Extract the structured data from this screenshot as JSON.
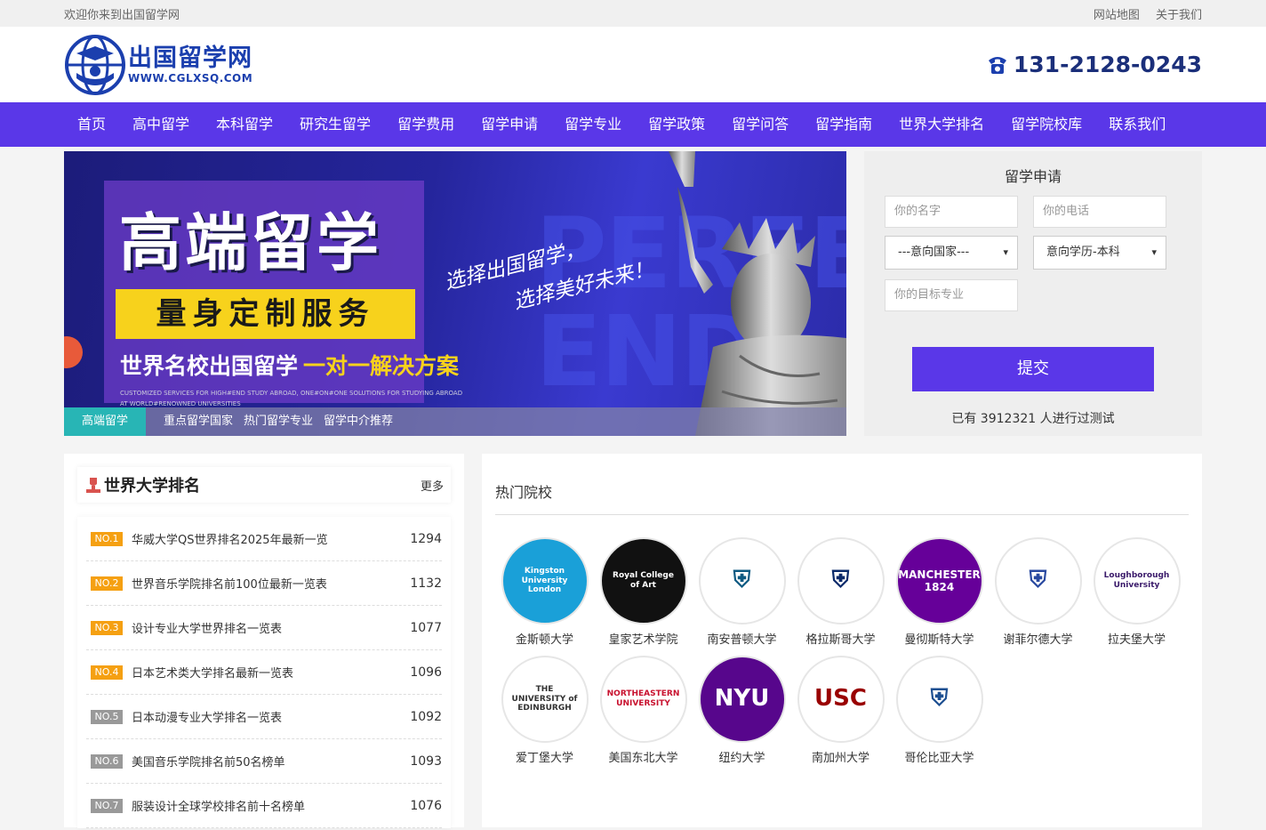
{
  "topbar": {
    "welcome": "欢迎你来到出国留学网",
    "sitemap": "网站地图",
    "about": "关于我们"
  },
  "header": {
    "logo_title": "出国留学网",
    "logo_sub": "WWW.CGLXSQ.COM",
    "phone": "131-2128-0243"
  },
  "nav": [
    "首页",
    "高中留学",
    "本科留学",
    "研究生留学",
    "留学费用",
    "留学申请",
    "留学专业",
    "留学政策",
    "留学问答",
    "留学指南",
    "世界大学排名",
    "留学院校库",
    "联系我们"
  ],
  "banner": {
    "big": "高端留学",
    "yellow": "量身定制服务",
    "line_a": "世界名校出国留学",
    "line_b": "一对一解决方案",
    "small": "CUSTOMIZED SERVICES FOR HIGH#END STUDY ABROAD, ONE#ON#ONE SOLUTIONS FOR STUDYING ABROAD AT WORLD#RENOWNED UNIVERSITIES",
    "script_1": "选择出国留学，",
    "script_2": "选择美好未来！",
    "bg_text_1": "PERFEC",
    "bg_text_2": "END",
    "tabs": [
      "高端留学",
      "重点留学国家",
      "热门留学专业",
      "留学中介推荐"
    ]
  },
  "form": {
    "title": "留学申请",
    "name_placeholder": "你的名字",
    "phone_placeholder": "你的电话",
    "country_value": "---意向国家---",
    "degree_value": "意向学历-本科",
    "major_placeholder": "你的目标专业",
    "submit": "提交",
    "count_text": "已有 3912321 人进行过测试"
  },
  "ranking": {
    "title": "世界大学排名",
    "more": "更多",
    "items": [
      {
        "no": "NO.1",
        "text": "华威大学QS世界排名2025年最新一览",
        "count": "1294"
      },
      {
        "no": "NO.2",
        "text": "世界音乐学院排名前100位最新一览表",
        "count": "1132"
      },
      {
        "no": "NO.3",
        "text": "设计专业大学世界排名一览表",
        "count": "1077"
      },
      {
        "no": "NO.4",
        "text": "日本艺术类大学排名最新一览表",
        "count": "1096"
      },
      {
        "no": "NO.5",
        "text": "日本动漫专业大学排名一览表",
        "count": "1092"
      },
      {
        "no": "NO.6",
        "text": "美国音乐学院排名前50名榜单",
        "count": "1093"
      },
      {
        "no": "NO.7",
        "text": "服装设计全球学校排名前十名榜单",
        "count": "1076"
      }
    ]
  },
  "hot": {
    "title": "热门院校",
    "schools": [
      {
        "name": "金斯顿大学",
        "logo_text": "Kingston University London",
        "bg": "#1aa0d8",
        "fg": "#ffffff"
      },
      {
        "name": "皇家艺术学院",
        "logo_text": "Royal College of Art",
        "bg": "#111111",
        "fg": "#ffffff"
      },
      {
        "name": "南安普顿大学",
        "logo_text": "⛨",
        "bg": "#ffffff",
        "fg": "#0e5a82"
      },
      {
        "name": "格拉斯哥大学",
        "logo_text": "⛨",
        "bg": "#ffffff",
        "fg": "#0a2a6a"
      },
      {
        "name": "曼彻斯特大学",
        "logo_text": "MANCHESTER 1824",
        "bg": "#660099",
        "fg": "#ffffff"
      },
      {
        "name": "谢菲尔德大学",
        "logo_text": "⛨",
        "bg": "#ffffff",
        "fg": "#2a4aa0"
      },
      {
        "name": "拉夫堡大学",
        "logo_text": "Loughborough University",
        "bg": "#ffffff",
        "fg": "#3a1a6a"
      },
      {
        "name": "爱丁堡大学",
        "logo_text": "THE UNIVERSITY of EDINBURGH",
        "bg": "#ffffff",
        "fg": "#333333"
      },
      {
        "name": "美国东北大学",
        "logo_text": "NORTHEASTERN UNIVERSITY",
        "bg": "#ffffff",
        "fg": "#c8102e"
      },
      {
        "name": "纽约大学",
        "logo_text": "NYU",
        "bg": "#57068c",
        "fg": "#ffffff"
      },
      {
        "name": "南加州大学",
        "logo_text": "USC",
        "bg": "#ffffff",
        "fg": "#990000"
      },
      {
        "name": "哥伦比亚大学",
        "logo_text": "⛨",
        "bg": "#ffffff",
        "fg": "#1d4f91"
      }
    ]
  },
  "colors": {
    "brand": "#5a37e8",
    "accent_yellow": "#f7d21c",
    "rank_top": "#f5a012",
    "rank_other": "#999999",
    "tab_active": "#28b5b5"
  }
}
